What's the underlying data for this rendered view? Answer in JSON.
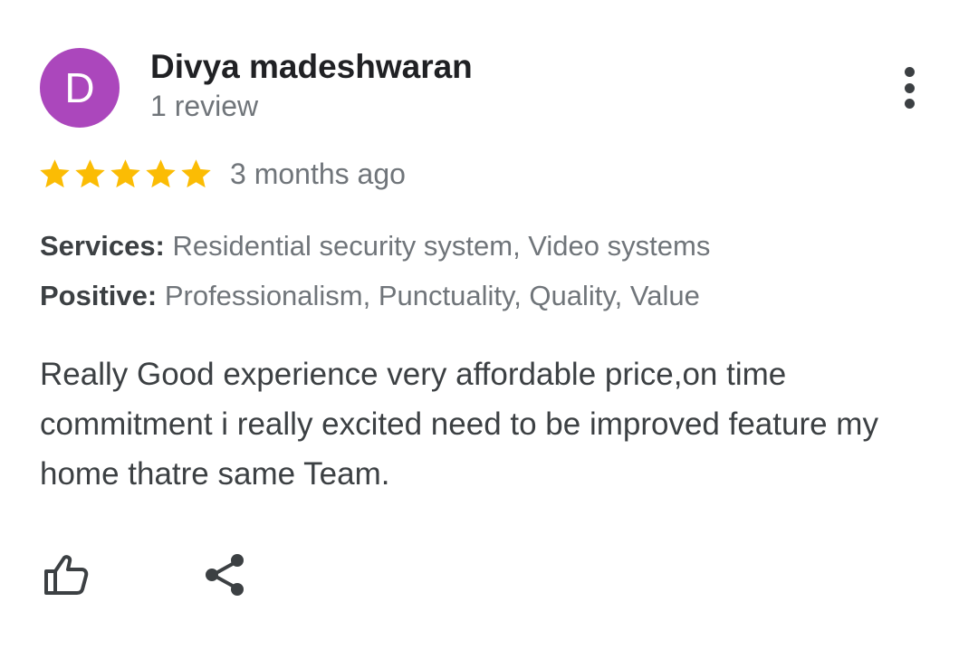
{
  "review": {
    "avatar_initial": "D",
    "author_name": "Divya madeshwaran",
    "review_count": "1 review",
    "rating": 5,
    "rating_max": 5,
    "time_ago": "3 months ago",
    "services_label": "Services:",
    "services_value": " Residential security system, Video systems",
    "positive_label": "Positive:",
    "positive_value": " Professionalism, Punctuality, Quality, Value",
    "text": "Really Good experience very affordable price,on time commitment i really excited need to be improved feature my home thatre same Team."
  },
  "icons": {
    "more": "more-vert-icon",
    "like": "thumbs-up-icon",
    "share": "share-icon",
    "star": "star-icon"
  },
  "colors": {
    "avatar_bg": "#ab47bc",
    "star": "#fbbc04",
    "name": "#202124",
    "secondary_text": "#70757a",
    "body_text": "#3c4043"
  }
}
